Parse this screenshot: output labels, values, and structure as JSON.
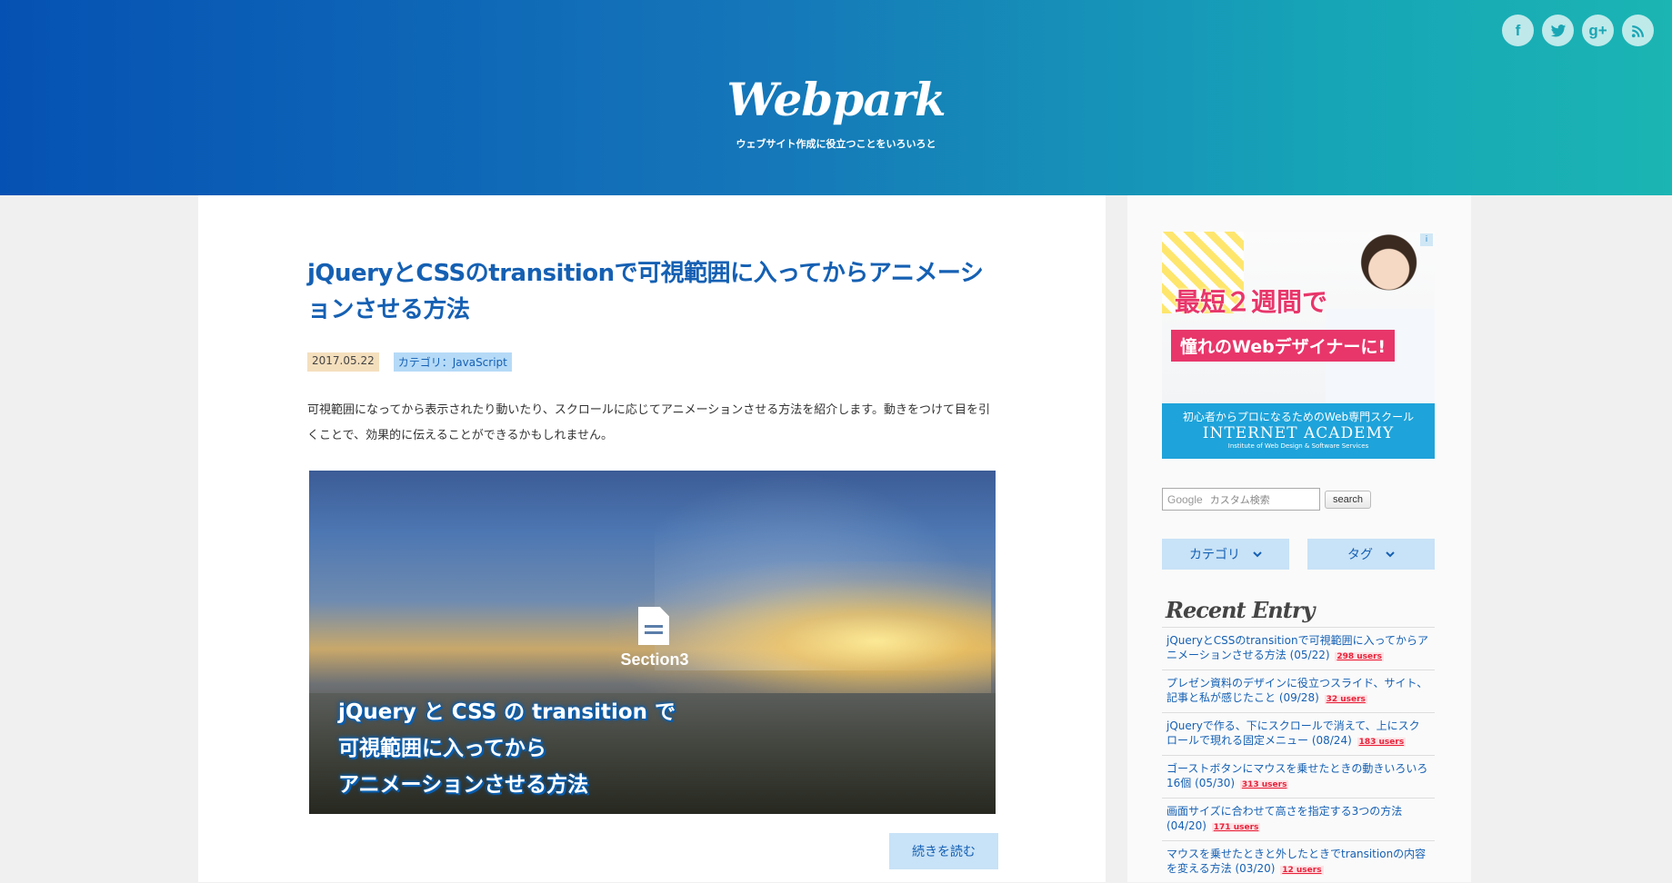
{
  "header": {
    "site_title": "Webpark",
    "site_description": "ウェブサイト作成に役立つことをいろいろと",
    "social": [
      {
        "name": "facebook",
        "glyph": "f"
      },
      {
        "name": "twitter",
        "glyph": "t"
      },
      {
        "name": "google-plus",
        "glyph": "g+"
      },
      {
        "name": "rss",
        "glyph": "rss"
      }
    ],
    "gradient_start": "#0551b3",
    "gradient_end": "#1bb5b3"
  },
  "post": {
    "title": "jQueryとCSSのtransitionで可視範囲に入ってからアニメーションさせる方法",
    "date": "2017.05.22",
    "category": "カテゴリ：JavaScript",
    "excerpt": "可視範囲になってから表示されたり動いたり、スクロールに応じてアニメーションさせる方法を紹介します。動きをつけて目を引くことで、効果的に伝えることができるかもしれません。",
    "thumbnail": {
      "section_label": "Section3",
      "caption_lines": [
        "jQuery と CSS の transition で",
        "可視範囲に入ってから",
        "アニメーションさせる方法"
      ]
    },
    "read_more": "続きを読む"
  },
  "sidebar": {
    "ad": {
      "headline1": "最短２週間で",
      "headline2": "憧れのWebデザイナーに!",
      "footer_line1": "初心者からプロになるためのWeb専門スクール",
      "footer_line2": "INTERNET ACADEMY",
      "footer_line3": "Institute of Web Design & Software Services",
      "badge": "i"
    },
    "search": {
      "google_label": "Google",
      "placeholder": "カスタム検索",
      "button": "search"
    },
    "dropdowns": [
      {
        "label": "カテゴリ"
      },
      {
        "label": "タグ"
      }
    ],
    "recent_title": "Recent Entry",
    "recent_entries": [
      {
        "text": "jQueryとCSSのtransitionで可視範囲に入ってからアニメーションさせる方法 (05/22)",
        "users": "298 users"
      },
      {
        "text": "プレゼン資料のデザインに役立つスライド、サイト、記事と私が感じたこと (09/28)",
        "users": "32 users"
      },
      {
        "text": "jQueryで作る、下にスクロールで消えて、上にスクロールで現れる固定メニュー (08/24)",
        "users": "183 users"
      },
      {
        "text": "ゴーストボタンにマウスを乗せたときの動きいろいろ16個 (05/30)",
        "users": "313 users"
      },
      {
        "text": "画面サイズに合わせて高さを指定する3つの方法 (04/20)",
        "users": "171 users"
      },
      {
        "text": "マウスを乗せたときと外したときでtransitionの内容を変える方法 (03/20)",
        "users": "12 users"
      }
    ]
  }
}
